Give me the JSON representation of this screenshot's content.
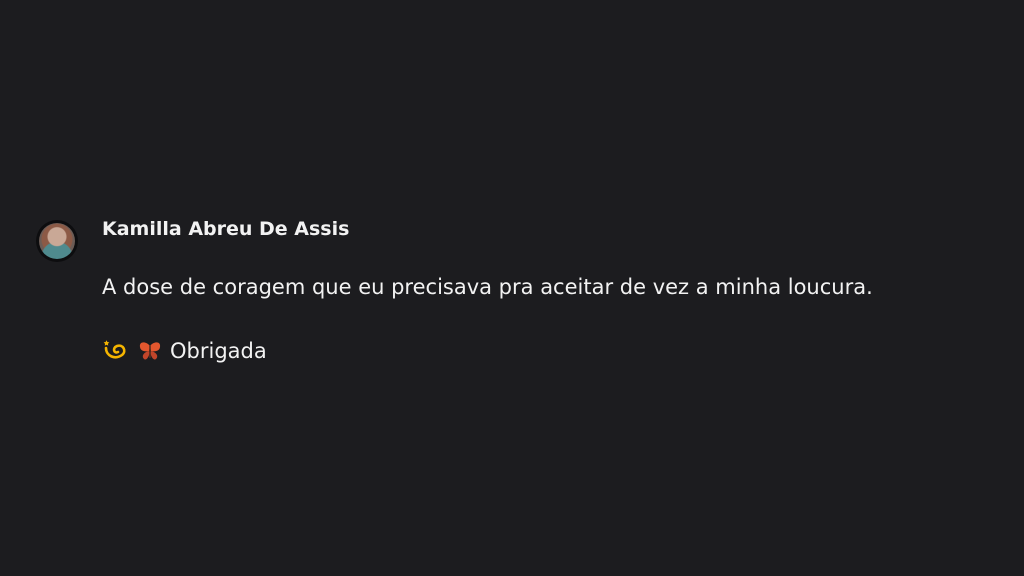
{
  "comment": {
    "author": "Kamilla Abreu De Assis",
    "text": "A dose de coragem que eu precisava pra aceitar de vez a minha loucura.",
    "reply": {
      "emojis": [
        "dizzy-icon",
        "butterfly-icon"
      ],
      "text": "Obrigada"
    }
  },
  "colors": {
    "background": "#1c1c1f",
    "text": "#f2f2f2",
    "dizzy": "#f5b500",
    "butterfly": "#e4572e"
  }
}
